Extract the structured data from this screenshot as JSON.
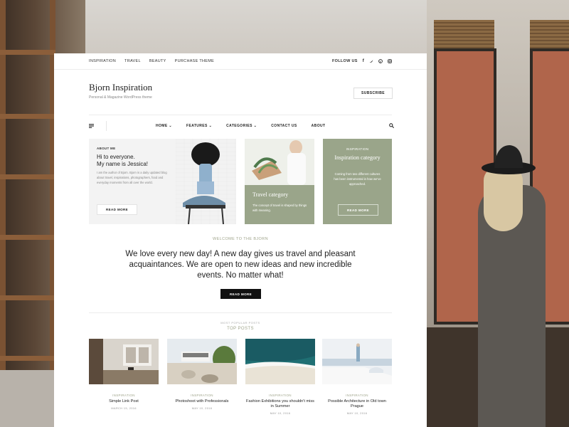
{
  "topbar": {
    "links": [
      "INSPIRATION",
      "TRAVEL",
      "BEAUTY",
      "PURCHASE THEME"
    ],
    "follow_label": "FOLLOW US",
    "social_icons": [
      "facebook-icon",
      "twitter-icon",
      "pinterest-icon",
      "instagram-icon"
    ]
  },
  "header": {
    "site_title": "Bjorn Inspiration",
    "tagline": "Personal & Magazine WordPress theme",
    "subscribe_label": "SUBSCRIBE"
  },
  "nav": {
    "items": [
      {
        "label": "HOME",
        "has_dropdown": true
      },
      {
        "label": "FEATURES",
        "has_dropdown": true
      },
      {
        "label": "CATEGORIES",
        "has_dropdown": true
      },
      {
        "label": "CONTACT US",
        "has_dropdown": false
      },
      {
        "label": "ABOUT",
        "has_dropdown": false
      }
    ],
    "dropdown_glyph": "⌄"
  },
  "about": {
    "label": "ABOUT ME",
    "greeting": "Hi to everyone.\nMy name is Jessica!",
    "body": "I am the author of Bjorn. Bjorn is a daily updated blog about travel, inspirations, photographers, food and everyday moments from all over the world.",
    "button": "READ MORE"
  },
  "travel_card": {
    "title": "Travel category",
    "text": "The concept of travel is shaped by things with meaning."
  },
  "inspiration_card": {
    "label": "INSPIRATION",
    "title": "Inspiration category",
    "text": "Coming from two different cultures has been instrumental in how we’ve approached.",
    "button": "READ MORE"
  },
  "welcome": {
    "label": "WELCOME TO THE BJORN",
    "lead": "We love every new day! A new day gives us travel and pleasant acquaintances. We are open to new ideas and new incredible events. No matter what!",
    "button": "READ MORE"
  },
  "top_posts": {
    "kicker": "MOST POPULAR POSTS",
    "heading": "TOP POSTS",
    "posts": [
      {
        "category": "INSPIRATION",
        "title": "Simple Link Post",
        "date": "MARCH 15, 2016"
      },
      {
        "category": "INSPIRATION",
        "title": "Photoshoot with Professionals",
        "date": "MAY 10, 2016"
      },
      {
        "category": "INSPIRATION",
        "title": "Fashion Exhibitions you shouldn't miss in Summer",
        "date": "MAY 10, 2016"
      },
      {
        "category": "INSPIRATION",
        "title": "Possible Architecture in Old town Prague",
        "date": "MAY 10, 2016"
      }
    ]
  },
  "colors": {
    "accent_green": "#9aa58a",
    "text_dark": "#222222",
    "muted": "#888888"
  }
}
